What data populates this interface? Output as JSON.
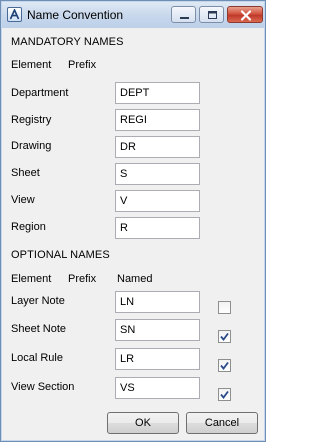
{
  "window": {
    "title": "Name Convention"
  },
  "mandatory": {
    "heading": "MANDATORY NAMES",
    "col_element": "Element",
    "col_prefix": "Prefix",
    "rows": [
      {
        "label": "Department",
        "prefix": "DEPT"
      },
      {
        "label": "Registry",
        "prefix": "REGI"
      },
      {
        "label": "Drawing",
        "prefix": "DR"
      },
      {
        "label": "Sheet",
        "prefix": "S"
      },
      {
        "label": "View",
        "prefix": "V"
      },
      {
        "label": "Region",
        "prefix": "R"
      }
    ]
  },
  "optional": {
    "heading": "OPTIONAL NAMES",
    "col_element": "Element",
    "col_prefix": "Prefix",
    "col_named": "Named",
    "rows": [
      {
        "label": "Layer Note",
        "prefix": "LN",
        "named": false
      },
      {
        "label": "Sheet Note",
        "prefix": "SN",
        "named": true
      },
      {
        "label": "Local Rule",
        "prefix": "LR",
        "named": true
      },
      {
        "label": "View Section",
        "prefix": "VS",
        "named": true
      }
    ]
  },
  "buttons": {
    "ok": "OK",
    "cancel": "Cancel"
  },
  "icons": {
    "app": "app-a-icon",
    "minimize": "minimize-icon",
    "maximize": "maximize-icon",
    "close": "close-icon",
    "check": "checkmark-icon"
  },
  "colors": {
    "titlebar": "#c9d8ec",
    "close_button": "#c0392b",
    "checkmark": "#2a4a8a",
    "window_bg": "#f0f0f0"
  }
}
